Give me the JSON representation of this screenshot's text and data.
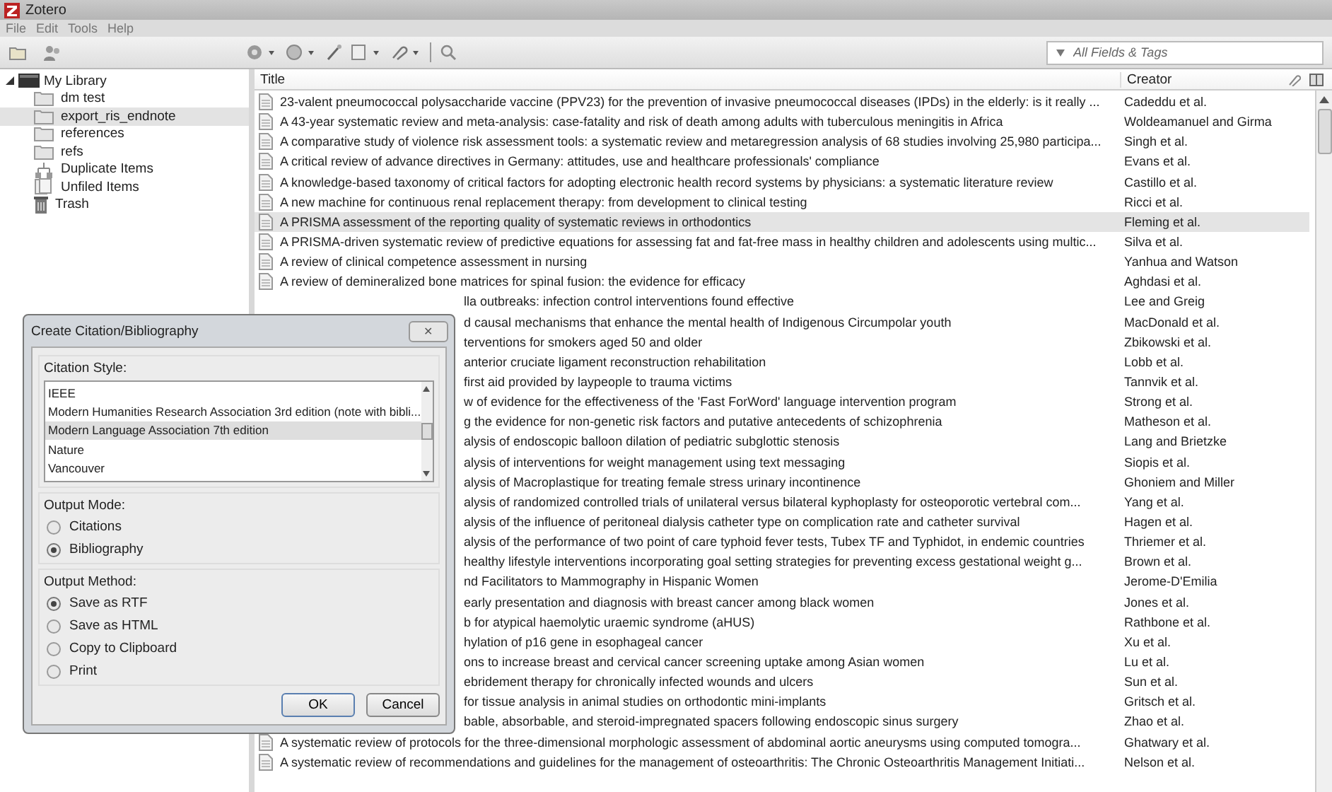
{
  "window": {
    "title": "Zotero"
  },
  "menu": [
    "File",
    "Edit",
    "Tools",
    "Help"
  ],
  "search": {
    "placeholder": "All Fields & Tags"
  },
  "sidebar": {
    "items": [
      {
        "label": "My Library",
        "kind": "library",
        "selected": false,
        "expanded": true,
        "children": [
          {
            "label": "dm test",
            "kind": "folder",
            "selected": false
          },
          {
            "label": "export_ris_endnote",
            "kind": "folder",
            "selected": true
          },
          {
            "label": "references",
            "kind": "folder",
            "selected": false
          },
          {
            "label": "refs",
            "kind": "folder",
            "selected": false
          },
          {
            "label": "Duplicate Items",
            "kind": "duplicates",
            "selected": false
          },
          {
            "label": "Unfiled Items",
            "kind": "unfiled",
            "selected": false
          },
          {
            "label": "Trash",
            "kind": "trash",
            "selected": false
          }
        ]
      }
    ]
  },
  "table": {
    "columns": [
      "Title",
      "Creator"
    ],
    "rows": [
      {
        "title": "23-valent pneumococcal polysaccharide vaccine (PPV23) for the prevention of invasive pneumococcal diseases (IPDs) in the elderly: is it really ...",
        "creator": "Cadeddu et al.",
        "selected": false,
        "kind": "full"
      },
      {
        "title": "A 43-year systematic review and meta-analysis: case-fatality and risk of death among adults with tuberculous meningitis in Africa",
        "creator": "Woldeamanuel and Girma",
        "selected": false,
        "kind": "full"
      },
      {
        "title": "A comparative study of violence risk assessment tools: a systematic review and metaregression analysis of 68 studies involving 25,980 participa...",
        "creator": "Singh et al.",
        "selected": false,
        "kind": "full"
      },
      {
        "title": "A critical review of advance directives in Germany: attitudes, use and healthcare professionals' compliance",
        "creator": "Evans et al.",
        "selected": false,
        "kind": "full"
      },
      {
        "title": "A knowledge-based taxonomy of critical factors for adopting electronic health record systems by physicians: a systematic literature review",
        "creator": "Castillo et al.",
        "selected": false,
        "kind": "full"
      },
      {
        "title": "A new machine for continuous renal replacement therapy: from development to clinical testing",
        "creator": "Ricci et al.",
        "selected": false,
        "kind": "full"
      },
      {
        "title": "A PRISMA assessment of the reporting quality of systematic reviews in orthodontics",
        "creator": "Fleming et al.",
        "selected": true,
        "kind": "full"
      },
      {
        "title": "A PRISMA-driven systematic review of predictive equations for assessing fat and fat-free mass in healthy children and adolescents using multic...",
        "creator": "Silva et al.",
        "selected": false,
        "kind": "full"
      },
      {
        "title": "A review of clinical competence assessment in nursing",
        "creator": "Yanhua and Watson",
        "selected": false,
        "kind": "full"
      },
      {
        "title": "A review of demineralized bone matrices for spinal fusion: the evidence for efficacy",
        "creator": "Aghdasi et al.",
        "selected": false,
        "kind": "full"
      },
      {
        "title": "lla outbreaks: infection control interventions found effective",
        "creator": "Lee and Greig",
        "selected": false,
        "kind": "partial"
      },
      {
        "title": "d causal mechanisms that enhance the mental health of Indigenous Circumpolar youth",
        "creator": "MacDonald et al.",
        "selected": false,
        "kind": "partial"
      },
      {
        "title": "terventions for smokers aged 50 and older",
        "creator": "Zbikowski et al.",
        "selected": false,
        "kind": "partial"
      },
      {
        "title": "anterior cruciate ligament reconstruction rehabilitation",
        "creator": "Lobb et al.",
        "selected": false,
        "kind": "partial"
      },
      {
        "title": "first aid provided by laypeople to trauma victims",
        "creator": "Tannvik et al.",
        "selected": false,
        "kind": "partial"
      },
      {
        "title": "w of evidence for the effectiveness of the 'Fast ForWord' language intervention program",
        "creator": "Strong et al.",
        "selected": false,
        "kind": "partial"
      },
      {
        "title": "g the evidence for non-genetic risk factors and putative antecedents of schizophrenia",
        "creator": "Matheson et al.",
        "selected": false,
        "kind": "partial"
      },
      {
        "title": "alysis of endoscopic balloon dilation of pediatric subglottic stenosis",
        "creator": "Lang and Brietzke",
        "selected": false,
        "kind": "partial"
      },
      {
        "title": "alysis of interventions for weight management using text messaging",
        "creator": "Siopis et al.",
        "selected": false,
        "kind": "partial"
      },
      {
        "title": "alysis of Macroplastique for treating female stress urinary incontinence",
        "creator": "Ghoniem and Miller",
        "selected": false,
        "kind": "partial"
      },
      {
        "title": "alysis of randomized controlled trials of unilateral versus bilateral kyphoplasty for osteoporotic vertebral com...",
        "creator": "Yang et al.",
        "selected": false,
        "kind": "partial"
      },
      {
        "title": "alysis of the influence of peritoneal dialysis catheter type on complication rate and catheter survival",
        "creator": "Hagen et al.",
        "selected": false,
        "kind": "partial"
      },
      {
        "title": "alysis of the performance of two point of care typhoid fever tests, Tubex TF and Typhidot, in endemic countries",
        "creator": "Thriemer et al.",
        "selected": false,
        "kind": "partial"
      },
      {
        "title": "healthy lifestyle interventions incorporating goal setting strategies for preventing excess gestational weight g...",
        "creator": "Brown et al.",
        "selected": false,
        "kind": "partial"
      },
      {
        "title": "nd Facilitators to Mammography in Hispanic Women",
        "creator": "Jerome-D'Emilia",
        "selected": false,
        "kind": "partial"
      },
      {
        "title": "early presentation and diagnosis with breast cancer among black women",
        "creator": "Jones et al.",
        "selected": false,
        "kind": "partial"
      },
      {
        "title": "b for atypical haemolytic uraemic syndrome (aHUS)",
        "creator": "Rathbone et al.",
        "selected": false,
        "kind": "partial"
      },
      {
        "title": "hylation of p16 gene in esophageal cancer",
        "creator": "Xu et al.",
        "selected": false,
        "kind": "partial"
      },
      {
        "title": "ons to increase breast and cervical cancer screening uptake among Asian women",
        "creator": "Lu et al.",
        "selected": false,
        "kind": "partial"
      },
      {
        "title": "ebridement therapy for chronically infected wounds and ulcers",
        "creator": "Sun et al.",
        "selected": false,
        "kind": "partial"
      },
      {
        "title": "for tissue analysis in animal studies on orthodontic mini-implants",
        "creator": "Gritsch et al.",
        "selected": false,
        "kind": "partial"
      },
      {
        "title": "bable, absorbable, and steroid-impregnated spacers following endoscopic sinus surgery",
        "creator": "Zhao et al.",
        "selected": false,
        "kind": "partial"
      },
      {
        "title": "A systematic review of protocols for the three-dimensional morphologic assessment of abdominal aortic aneurysms using computed tomogra...",
        "creator": "Ghatwary et al.",
        "selected": false,
        "kind": "full"
      },
      {
        "title": "A systematic review of recommendations and guidelines for the management of osteoarthritis: The Chronic Osteoarthritis Management Initiati...",
        "creator": "Nelson et al.",
        "selected": false,
        "kind": "full"
      }
    ]
  },
  "dialog": {
    "title": "Create Citation/Bibliography",
    "close": "✕",
    "citation_style": {
      "label": "Citation Style:",
      "items": [
        {
          "label": "IEEE",
          "selected": false
        },
        {
          "label": "Modern Humanities Research Association 3rd edition (note with bibli...",
          "selected": false
        },
        {
          "label": "Modern Language Association 7th edition",
          "selected": true
        },
        {
          "label": "Nature",
          "selected": false
        },
        {
          "label": "Vancouver",
          "selected": false
        }
      ]
    },
    "output_mode": {
      "label": "Output Mode:",
      "options": [
        {
          "label": "Citations",
          "selected": false
        },
        {
          "label": "Bibliography",
          "selected": true
        }
      ]
    },
    "output_method": {
      "label": "Output Method:",
      "options": [
        {
          "label": "Save as RTF",
          "selected": true
        },
        {
          "label": "Save as HTML",
          "selected": false
        },
        {
          "label": "Copy to Clipboard",
          "selected": false
        },
        {
          "label": "Print",
          "selected": false
        }
      ]
    },
    "buttons": [
      "OK",
      "Cancel"
    ]
  }
}
